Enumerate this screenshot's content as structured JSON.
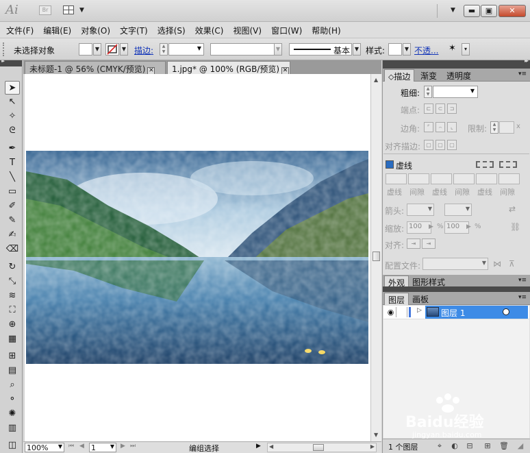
{
  "titlebar": {
    "app_logo": "Ai",
    "bridge_label": "Br",
    "window_buttons": [
      "▬",
      "▣",
      "✕"
    ]
  },
  "menu": [
    {
      "id": "file",
      "label": "文件(F)"
    },
    {
      "id": "edit",
      "label": "编辑(E)"
    },
    {
      "id": "object",
      "label": "对象(O)"
    },
    {
      "id": "type",
      "label": "文字(T)"
    },
    {
      "id": "select",
      "label": "选择(S)"
    },
    {
      "id": "effect",
      "label": "效果(C)"
    },
    {
      "id": "view",
      "label": "视图(V)"
    },
    {
      "id": "window",
      "label": "窗口(W)"
    },
    {
      "id": "help",
      "label": "帮助(H)"
    }
  ],
  "controlbar": {
    "selection_status": "未选择对象",
    "stroke_label": "描边:",
    "brush_label": "基本",
    "style_label": "样式:",
    "opacity_label": "不透..."
  },
  "tools": [
    {
      "name": "selection-tool",
      "glyph": "➤",
      "active": true
    },
    {
      "name": "direct-selection-tool",
      "glyph": "↖"
    },
    {
      "name": "magic-wand-tool",
      "glyph": "✧"
    },
    {
      "name": "lasso-tool",
      "glyph": "ᘓ"
    },
    {
      "name": "pen-tool",
      "glyph": "✒"
    },
    {
      "name": "type-tool",
      "glyph": "T"
    },
    {
      "name": "line-segment-tool",
      "glyph": "╲"
    },
    {
      "name": "rectangle-tool",
      "glyph": "▭"
    },
    {
      "name": "paintbrush-tool",
      "glyph": "✐"
    },
    {
      "name": "pencil-tool",
      "glyph": "✎"
    },
    {
      "name": "blob-brush-tool",
      "glyph": "✍"
    },
    {
      "name": "eraser-tool",
      "glyph": "⌫"
    },
    {
      "name": "rotate-tool",
      "glyph": "↻"
    },
    {
      "name": "scale-tool",
      "glyph": "⤡"
    },
    {
      "name": "warp-tool",
      "glyph": "≋"
    },
    {
      "name": "free-transform-tool",
      "glyph": "⛶"
    },
    {
      "name": "shape-builder-tool",
      "glyph": "⊕"
    },
    {
      "name": "perspective-grid-tool",
      "glyph": "▦"
    },
    {
      "name": "mesh-tool",
      "glyph": "⊞"
    },
    {
      "name": "gradient-tool",
      "glyph": "▤"
    },
    {
      "name": "eyedropper-tool",
      "glyph": "⌕"
    },
    {
      "name": "blend-tool",
      "glyph": "⚬"
    },
    {
      "name": "symbol-sprayer-tool",
      "glyph": "✺"
    },
    {
      "name": "column-graph-tool",
      "glyph": "▥"
    },
    {
      "name": "artboard-tool",
      "glyph": "◫"
    }
  ],
  "tabs": [
    {
      "label": "未标题-1 @ 56% (CMYK/预览)",
      "active": false
    },
    {
      "label": "1.jpg* @ 100% (RGB/预览)",
      "active": true
    }
  ],
  "tab_close_glyph": "✕",
  "statusbar": {
    "zoom": "100%",
    "page": "1",
    "mode": "编组选择"
  },
  "stroke_panel": {
    "tabs": [
      "描边",
      "渐变",
      "透明度"
    ],
    "weight_label": "粗细:",
    "cap_label": "端点:",
    "corner_label": "边角:",
    "limit_label": "限制:",
    "limit_unit": "x",
    "align_label": "对齐描边:",
    "dashed_label": "虚线",
    "dash_labels": [
      "虚线",
      "间隙",
      "虚线",
      "间隙",
      "虚线",
      "间隙"
    ],
    "arrow_label": "箭头:",
    "scale_label": "缩放:",
    "scale_values": [
      "100",
      "100"
    ],
    "percent": "%",
    "align_arrow_label": "对齐:",
    "profile_label": "配置文件:"
  },
  "appearance_panel": {
    "tabs": [
      "外观",
      "图形样式"
    ]
  },
  "layers_panel": {
    "tabs": [
      "图层",
      "画板"
    ],
    "layer_name": "图层 1",
    "footer_count": "1 个图层"
  },
  "watermark": {
    "brand": "Baidu经验",
    "url": "jingyan.baidu.com"
  },
  "colors": {
    "accent_selection": "#3d8be6",
    "close_button": "#c44a2c",
    "link": "#1033b8"
  }
}
